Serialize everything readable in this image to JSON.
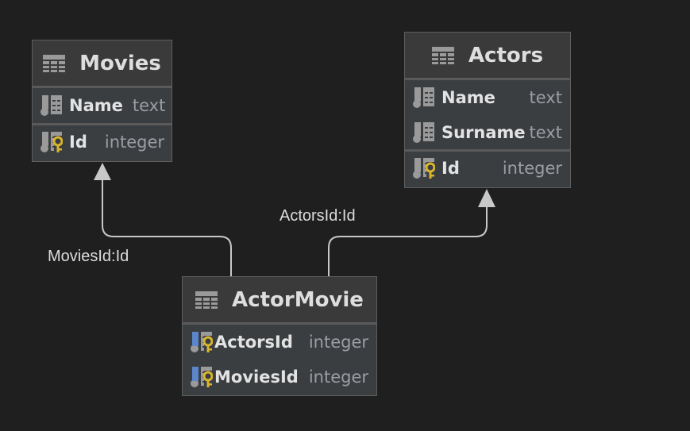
{
  "tables": [
    {
      "name": "Movies",
      "columns": [
        {
          "name": "Name",
          "type": "text",
          "key": false
        },
        {
          "name": "Id",
          "type": "integer",
          "key": "primary"
        }
      ]
    },
    {
      "name": "Actors",
      "columns": [
        {
          "name": "Name",
          "type": "text",
          "key": false
        },
        {
          "name": "Surname",
          "type": "text",
          "key": false
        },
        {
          "name": "Id",
          "type": "integer",
          "key": "primary"
        }
      ]
    },
    {
      "name": "ActorMovie",
      "columns": [
        {
          "name": "ActorsId",
          "type": "integer",
          "key": "primary-foreign"
        },
        {
          "name": "MoviesId",
          "type": "integer",
          "key": "primary-foreign"
        }
      ]
    }
  ],
  "relations": [
    {
      "label": "MoviesId:Id",
      "from": "ActorMovie",
      "to": "Movies"
    },
    {
      "label": "ActorsId:Id",
      "from": "ActorMovie",
      "to": "Actors"
    }
  ],
  "colors": {
    "background": "#1f1f1f",
    "key": "#d9b52b",
    "foreign": "#5b86c9",
    "line": "#c8c8c8"
  }
}
